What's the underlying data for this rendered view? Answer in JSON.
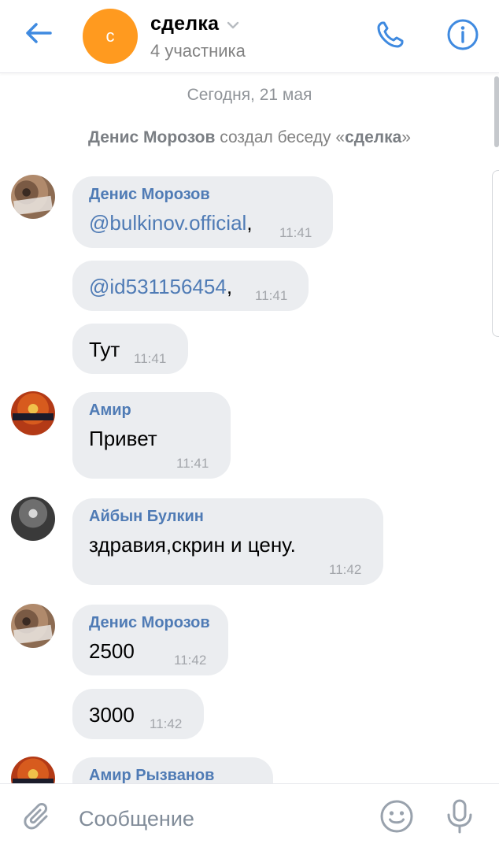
{
  "header": {
    "chat_title": "сделка",
    "chat_subtitle": "4 участника",
    "avatar_letter": "с",
    "avatar_color": "#ff9a1f",
    "accent_color": "#3f8ae0",
    "back_icon": "arrow-left-icon",
    "call_icon": "phone-icon",
    "info_icon": "info-icon"
  },
  "feed": {
    "date_separator": "Сегодня, 21 мая",
    "service": {
      "actor": "Денис Морозов",
      "action": "создал беседу",
      "chat_open": "«",
      "chat_name": "сделка",
      "chat_close": "»"
    },
    "messages": [
      {
        "sender": "Денис Морозов",
        "text": "@bulkinov.official",
        "suffix": ",",
        "time": "11:41"
      },
      {
        "text": "@id531156454",
        "suffix": ",",
        "time": "11:41"
      },
      {
        "text": "Тут",
        "time": "11:41"
      },
      {
        "sender": "Амир",
        "text": "Привет",
        "time": "11:41"
      },
      {
        "sender": "Айбын Булкин",
        "text": "здравия,скрин и цену.",
        "time": "11:42"
      },
      {
        "sender": "Денис Морозов",
        "text": "2500",
        "time": "11:42"
      },
      {
        "text": "3000",
        "time": "11:42"
      },
      {
        "sender": "Амир Рызванов"
      }
    ]
  },
  "composer": {
    "placeholder": "Сообщение",
    "attach_icon": "paperclip-icon",
    "emoji_icon": "smile-icon",
    "mic_icon": "microphone-icon"
  }
}
